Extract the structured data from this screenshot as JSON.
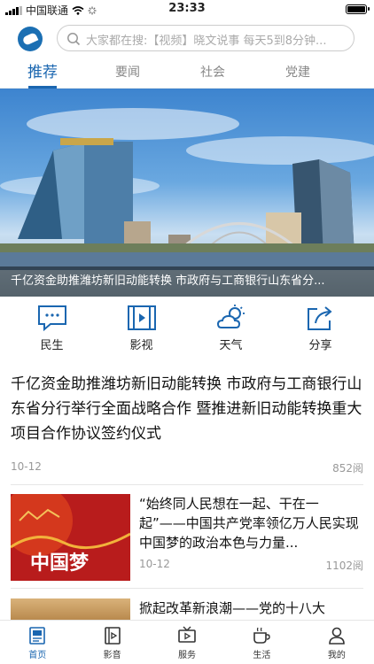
{
  "status": {
    "carrier": "中国联通",
    "time": "23:33"
  },
  "search": {
    "placeholder": "大家都在搜:【视频】晓文说事 每天5到8分钟..."
  },
  "tabs": [
    {
      "label": "推荐"
    },
    {
      "label": "要闻"
    },
    {
      "label": "社会"
    },
    {
      "label": "党建"
    }
  ],
  "banner": {
    "caption": "千亿资金助推潍坊新旧动能转换 市政府与工商银行山东省分..."
  },
  "quick": [
    {
      "label": "民生",
      "icon": "chat-icon"
    },
    {
      "label": "影视",
      "icon": "film-icon"
    },
    {
      "label": "天气",
      "icon": "weather-icon"
    },
    {
      "label": "分享",
      "icon": "share-icon"
    }
  ],
  "feature": {
    "title": "千亿资金助推潍坊新旧动能转换 市政府与工商银行山东省分行举行全面战略合作 暨推进新旧动能转换重大项目合作协议签约仪式",
    "date": "10-12",
    "reads": "852阅"
  },
  "articles": [
    {
      "title": "“始终同人民想在一起、干在一起”——中国共产党率领亿万人民实现中国梦的政治本色与力量...",
      "date": "10-12",
      "reads": "1102阅",
      "thumb_text": "中国梦"
    },
    {
      "title": "掀起改革新浪潮——党的十八大",
      "date": "",
      "reads": ""
    }
  ],
  "bottom_nav": [
    {
      "label": "首页",
      "icon": "home-icon"
    },
    {
      "label": "影音",
      "icon": "media-icon"
    },
    {
      "label": "服务",
      "icon": "tv-icon"
    },
    {
      "label": "生活",
      "icon": "coffee-icon"
    },
    {
      "label": "我的",
      "icon": "user-icon"
    }
  ],
  "colors": {
    "accent": "#1a66b0",
    "brand": "#1b6fb3"
  }
}
